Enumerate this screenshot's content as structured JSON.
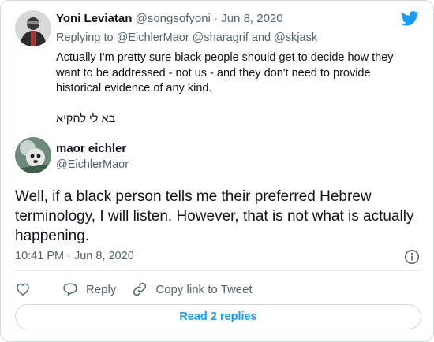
{
  "parent_tweet": {
    "author_name": "Yoni Leviatan",
    "author_handle": "@songsofyoni",
    "separator": " · ",
    "date": "Jun 8, 2020",
    "replying_prefix": "Replying to ",
    "mention_1": "@EichlerMaor",
    "mention_2": "@sharagrif",
    "and_word": " and ",
    "mention_3": "@skjask",
    "text_line": "Actually I'm pretty sure black people should get to decide how they want to be addressed - not us - and they don't need to provide historical evidence of any kind.",
    "text_hebrew": "בא לי להקיא"
  },
  "main_tweet": {
    "author_name": "maor eichler",
    "author_handle": "@EichlerMaor",
    "text": "Well, if a black person tells me their preferred Hebrew terminology, I will listen. However, that is not what is actually happening.",
    "time": "10:41 PM",
    "separator": " · ",
    "date": "Jun 8, 2020"
  },
  "actions": {
    "like_icon": "heart-icon",
    "reply_label": "Reply",
    "copy_link_label": "Copy link to Tweet"
  },
  "read_replies_label": "Read 2 replies",
  "colors": {
    "accent": "#1d9bf0",
    "secondary_text": "#536471",
    "primary_text": "#0f1419",
    "border": "#cfd9de"
  }
}
